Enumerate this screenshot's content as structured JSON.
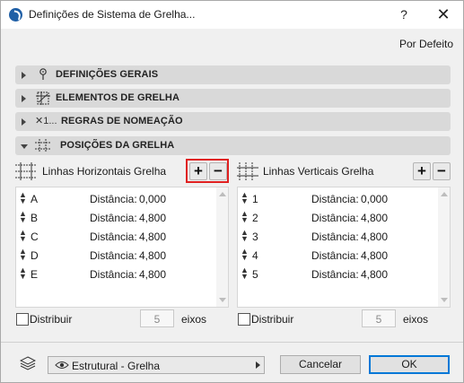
{
  "window": {
    "title": "Definições de Sistema de Grelha...",
    "help_label": "?",
    "close_label": "✕"
  },
  "defaults_label": "Por Defeito",
  "sections": [
    {
      "label": "DEFINIÇÕES GERAIS",
      "icon": "pin-icon",
      "expanded": false
    },
    {
      "label": "ELEMENTOS DE GRELHA",
      "icon": "grid-element-icon",
      "expanded": false
    },
    {
      "label": "REGRAS DE NOMEAÇÃO",
      "icon": "naming-rule-icon",
      "icon_text": "✕1...",
      "expanded": false
    },
    {
      "label": "POSIÇÕES DA GRELHA",
      "icon": "grid-positions-icon",
      "expanded": true
    }
  ],
  "horizontal": {
    "title": "Linhas Horizontais Grelha",
    "add_label": "+",
    "remove_label": "−",
    "rows": [
      {
        "name": "A",
        "label": "Distância:",
        "value": "0,000"
      },
      {
        "name": "B",
        "label": "Distância:",
        "value": "4,800"
      },
      {
        "name": "C",
        "label": "Distância:",
        "value": "4,800"
      },
      {
        "name": "D",
        "label": "Distância:",
        "value": "4,800"
      },
      {
        "name": "E",
        "label": "Distância:",
        "value": "4,800"
      }
    ],
    "distribute_label": "Distribuir",
    "distribute_checked": false,
    "axes_count": "5",
    "axes_label": "eixos"
  },
  "vertical": {
    "title": "Linhas Verticais Grelha",
    "add_label": "+",
    "remove_label": "−",
    "rows": [
      {
        "name": "1",
        "label": "Distância:",
        "value": "0,000"
      },
      {
        "name": "2",
        "label": "Distância:",
        "value": "4,800"
      },
      {
        "name": "3",
        "label": "Distância:",
        "value": "4,800"
      },
      {
        "name": "4",
        "label": "Distância:",
        "value": "4,800"
      },
      {
        "name": "5",
        "label": "Distância:",
        "value": "4,800"
      }
    ],
    "distribute_label": "Distribuir",
    "distribute_checked": false,
    "axes_count": "5",
    "axes_label": "eixos"
  },
  "footer": {
    "layer_value": "Estrutural - Grelha",
    "cancel_label": "Cancelar",
    "ok_label": "OK"
  },
  "colors": {
    "highlight": "#e02020",
    "accent": "#0078d7",
    "app_icon": "#1f5fa6"
  }
}
